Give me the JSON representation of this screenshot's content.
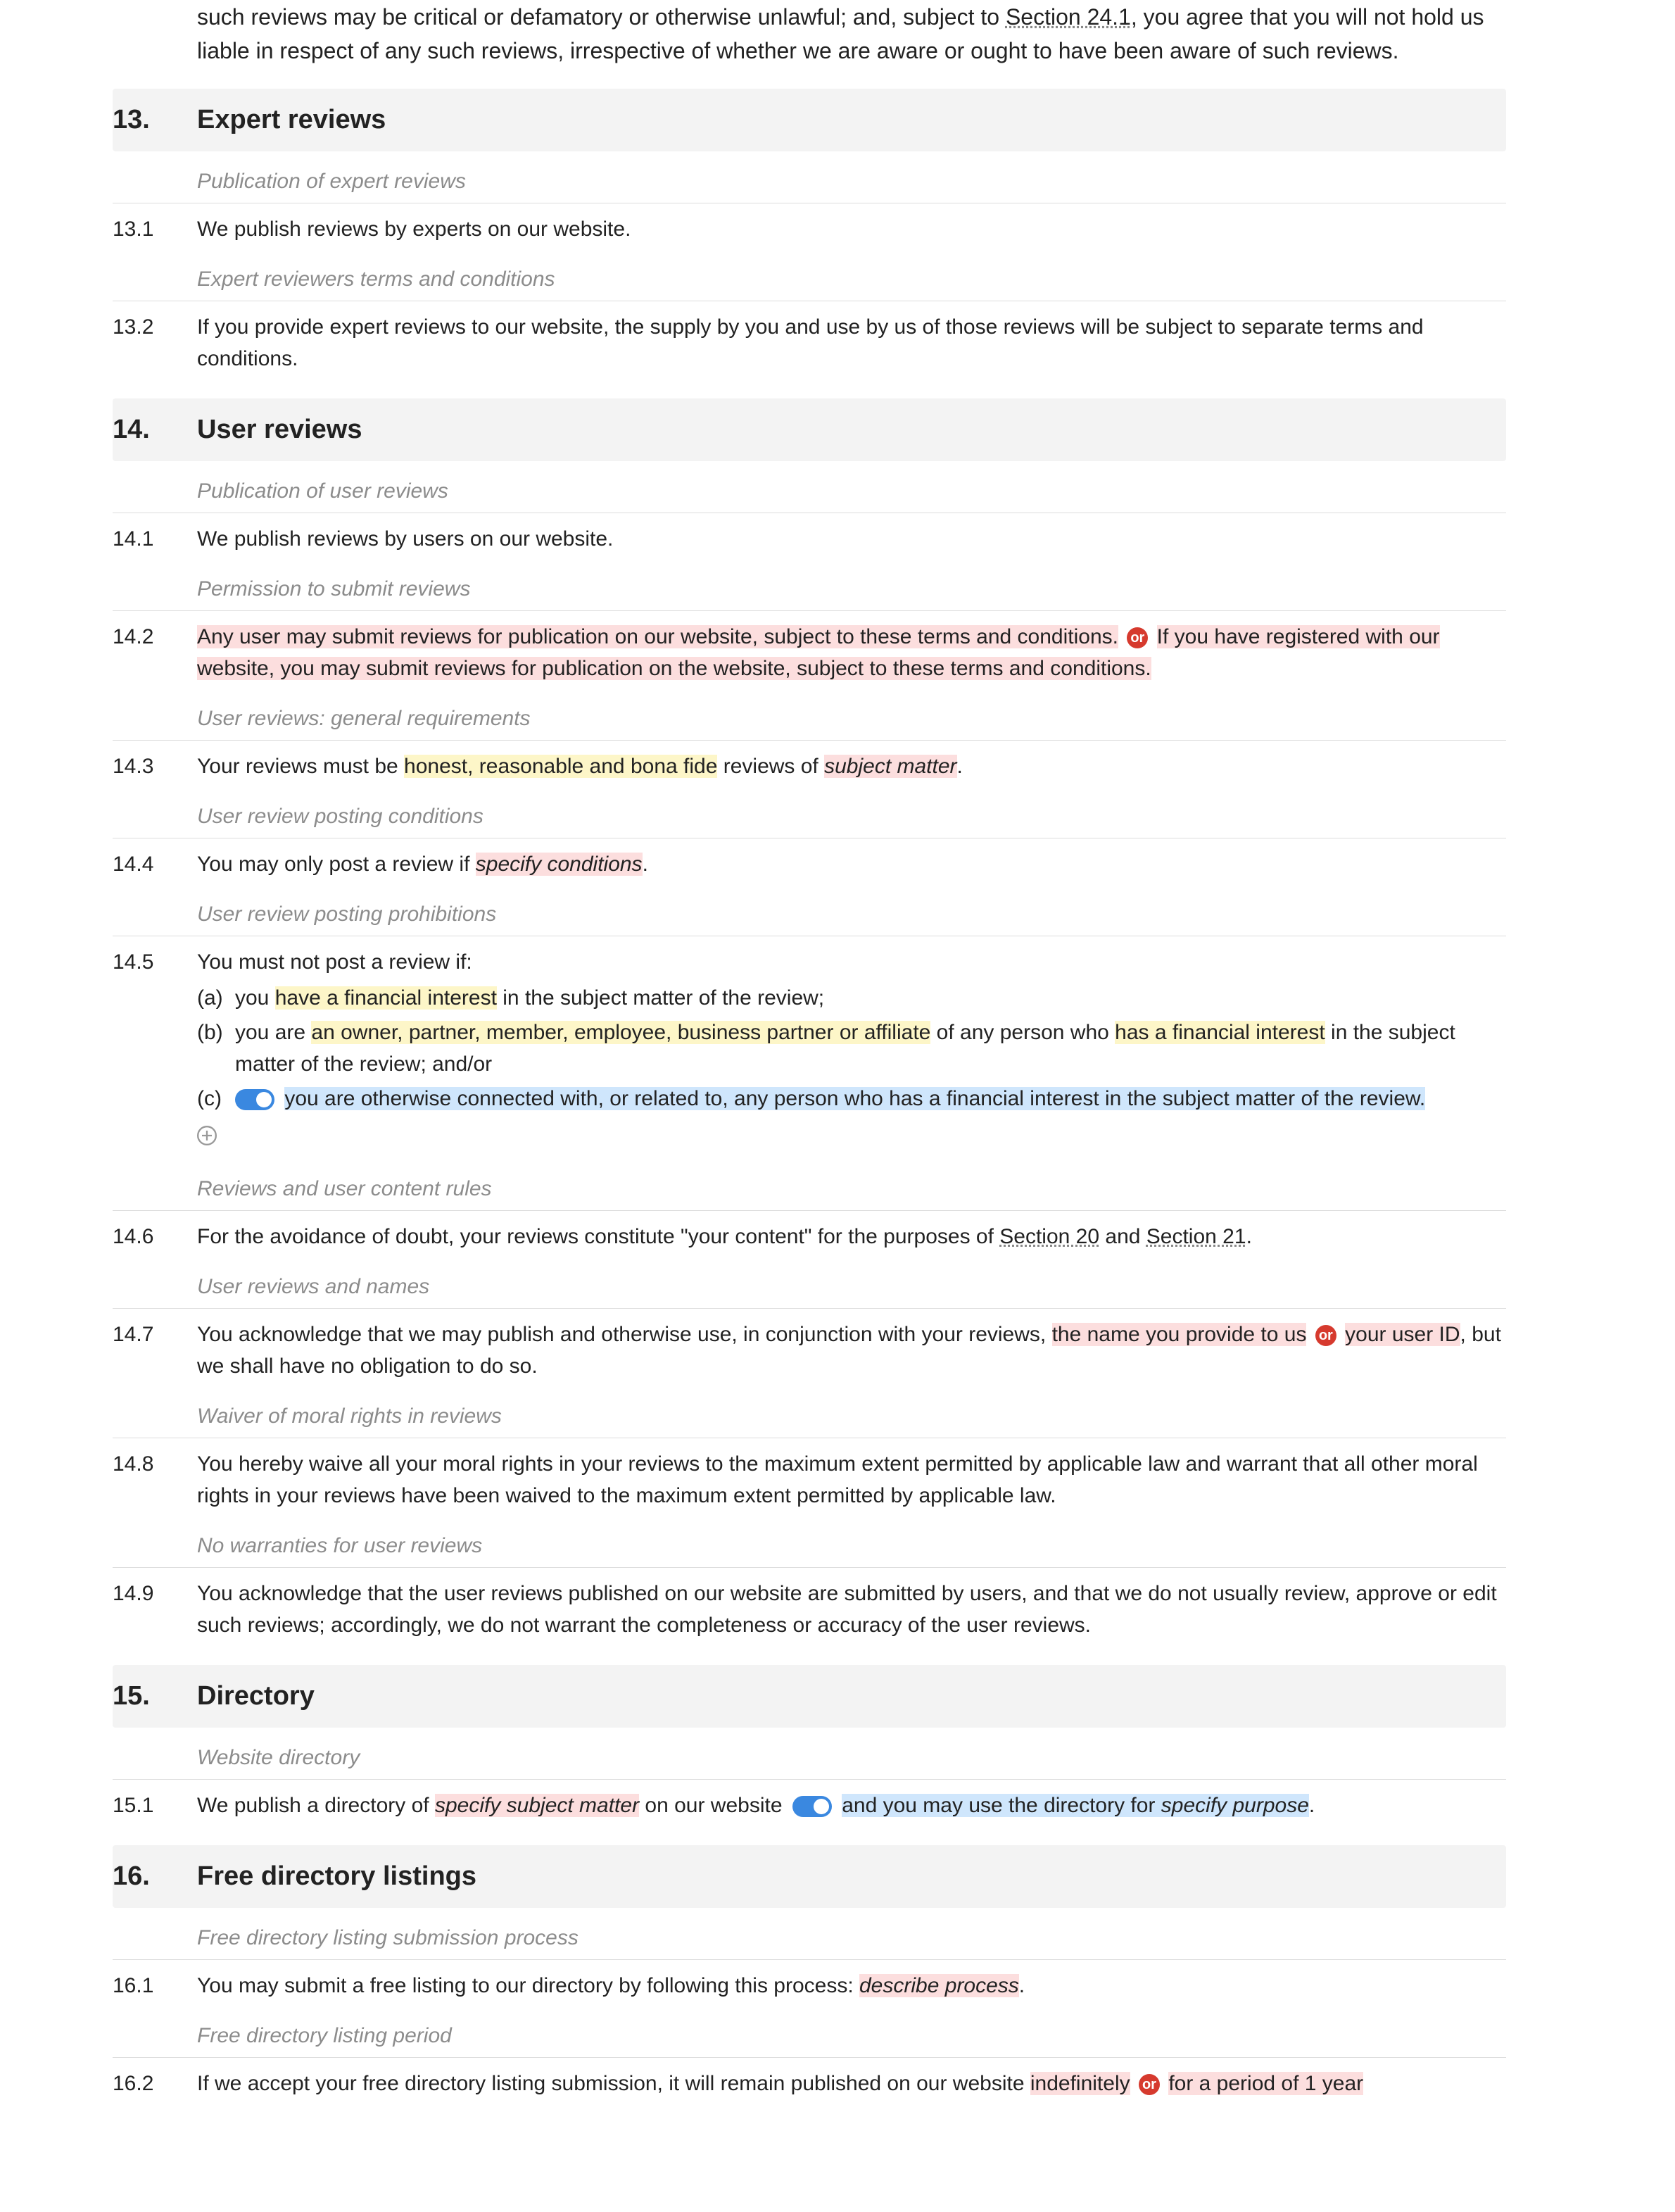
{
  "intro": {
    "text_pre": "such reviews may be critical or defamatory or otherwise unlawful; and, subject to ",
    "section_ref": "Section 24.1",
    "text_post": ", you agree that you will not hold us liable in respect of any such reviews, irrespective of whether we are aware or ought to have been aware of such reviews."
  },
  "s13": {
    "num": "13.",
    "title": "Expert reviews",
    "sub1_title": "Publication of expert reviews",
    "c1_num": "13.1",
    "c1_text": "We publish reviews by experts on our website.",
    "sub2_title": "Expert reviewers terms and conditions",
    "c2_num": "13.2",
    "c2_text": "If you provide expert reviews to our website, the supply by you and use by us of those reviews will be subject to separate terms and conditions."
  },
  "s14": {
    "num": "14.",
    "title": "User reviews",
    "sub1_title": "Publication of user reviews",
    "c1_num": "14.1",
    "c1_text": "We publish reviews by users on our website.",
    "sub2_title": "Permission to submit reviews",
    "c2_num": "14.2",
    "c2_opt1": "Any user may submit reviews for publication on our website, subject to these terms and conditions.",
    "c2_opt2": "If you have registered with our website, you may submit reviews for publication on the website, subject to these terms and conditions.",
    "sub3_title": "User reviews: general requirements",
    "c3_num": "14.3",
    "c3_pre": "Your reviews must be ",
    "c3_field1": "honest, reasonable and bona fide",
    "c3_mid": " reviews of ",
    "c3_field2": "subject matter",
    "c3_post": ".",
    "sub4_title": "User review posting conditions",
    "c4_num": "14.4",
    "c4_pre": "You may only post a review if ",
    "c4_field": "specify conditions",
    "c4_post": ".",
    "sub5_title": "User review posting prohibitions",
    "c5_num": "14.5",
    "c5_intro": "You must not post a review if:",
    "c5a_letter": "(a)",
    "c5a_pre": "you ",
    "c5a_field": "have a financial interest",
    "c5a_post": " in the subject matter of the review;",
    "c5b_letter": "(b)",
    "c5b_pre": "you are ",
    "c5b_field1": "an owner, partner, member, employee, business partner or affiliate",
    "c5b_mid": " of any person who ",
    "c5b_field2": "has a financial interest",
    "c5b_post": " in the subject matter of the review; and/or",
    "c5c_letter": "(c)",
    "c5c_text": "you are otherwise connected with, or related to, any person who has a financial interest in the subject matter of the review.",
    "sub6_title": "Reviews and user content rules",
    "c6_num": "14.6",
    "c6_pre": "For the avoidance of doubt, your reviews constitute \"your content\" for the purposes of ",
    "c6_ref1": "Section 20",
    "c6_and": " and ",
    "c6_ref2": "Section 21",
    "c6_post": ".",
    "sub7_title": "User reviews and names",
    "c7_num": "14.7",
    "c7_pre": "You acknowledge that we may publish and otherwise use, in conjunction with your reviews, ",
    "c7_opt1": "the name you provide to us",
    "c7_opt2": "your user ID",
    "c7_post": ", but we shall have no obligation to do so.",
    "sub8_title": "Waiver of moral rights in reviews",
    "c8_num": "14.8",
    "c8_text": "You hereby waive all your moral rights in your reviews to the maximum extent permitted by applicable law and warrant that all other moral rights in your reviews have been waived to the maximum extent permitted by applicable law.",
    "sub9_title": "No warranties for user reviews",
    "c9_num": "14.9",
    "c9_text": "You acknowledge that the user reviews published on our website are submitted by users, and that we do not usually review, approve or edit such reviews; accordingly, we do not warrant the completeness or accuracy of the user reviews."
  },
  "s15": {
    "num": "15.",
    "title": "Directory",
    "sub1_title": "Website directory",
    "c1_num": "15.1",
    "c1_pre": "We publish a directory of ",
    "c1_field1": "specify subject matter",
    "c1_mid": " on our website",
    "c1_opt_pre": " and you may use the directory for ",
    "c1_field2": "specify purpose",
    "c1_post": "."
  },
  "s16": {
    "num": "16.",
    "title": "Free directory listings",
    "sub1_title": "Free directory listing submission process",
    "c1_num": "16.1",
    "c1_pre": "You may submit a free listing to our directory by following this process: ",
    "c1_field": "describe process",
    "c1_post": ".",
    "sub2_title": "Free directory listing period",
    "c2_num": "16.2",
    "c2_pre": "If we accept your free directory listing submission, it will remain published on our website ",
    "c2_opt1": "indefinitely",
    "c2_opt2": "for a period of 1 year"
  },
  "or_label": "or"
}
